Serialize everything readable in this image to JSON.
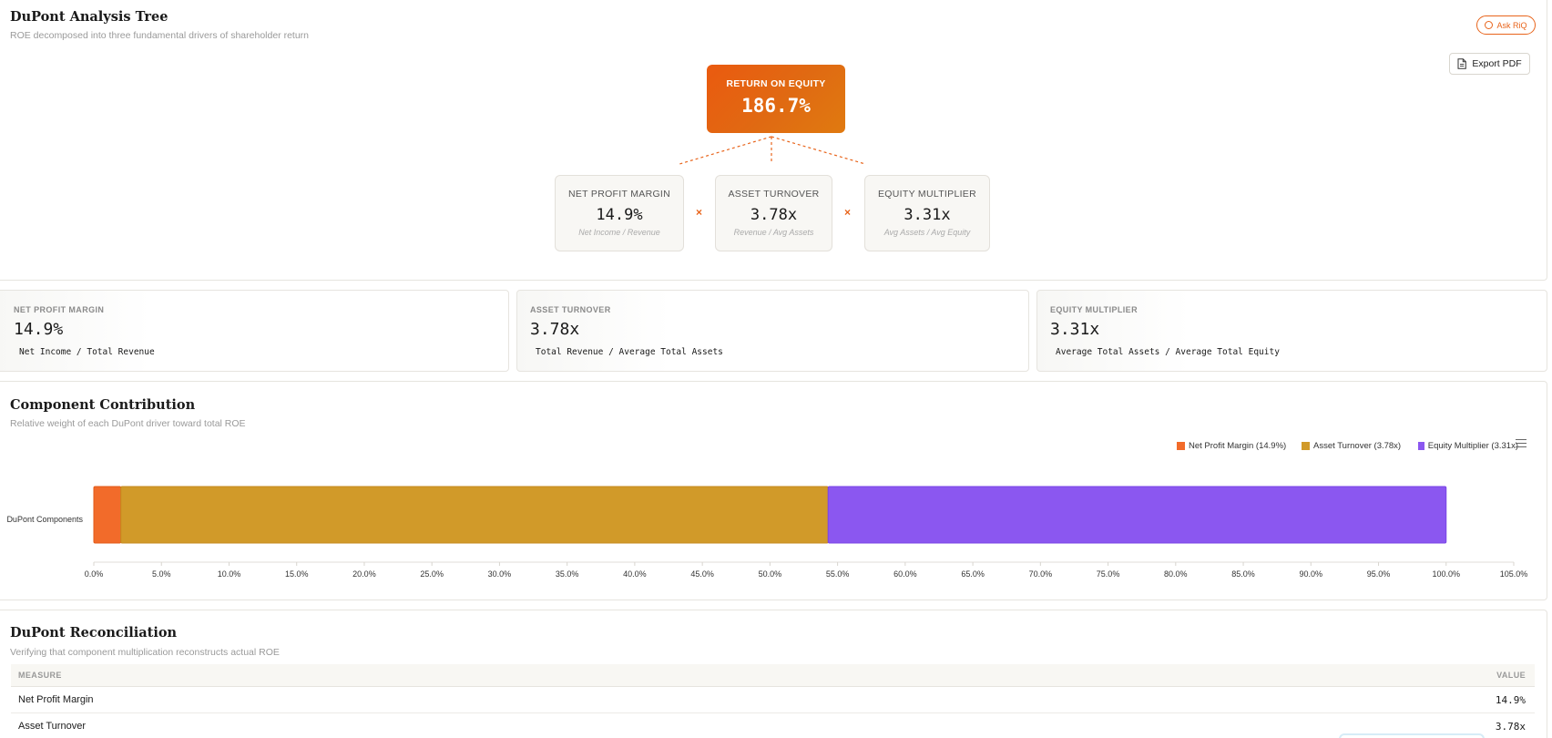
{
  "tree": {
    "title": "DuPont Analysis Tree",
    "subtitle": "ROE decomposed into three fundamental drivers of shareholder return",
    "ask_label": "Ask RiQ",
    "export_label": "Export PDF",
    "roe": {
      "label": "RETURN ON EQUITY",
      "value": "186.7%"
    },
    "operator": "×",
    "components": [
      {
        "label": "NET PROFIT MARGIN",
        "value": "14.9%",
        "formula": "Net Income / Revenue"
      },
      {
        "label": "ASSET TURNOVER",
        "value": "3.78x",
        "formula": "Revenue / Avg Assets"
      },
      {
        "label": "EQUITY MULTIPLIER",
        "value": "3.31x",
        "formula": "Avg Assets / Avg Equity"
      }
    ]
  },
  "kpis": [
    {
      "label": "NET PROFIT MARGIN",
      "value": "14.9%",
      "formula": "Net Income / Total Revenue"
    },
    {
      "label": "ASSET TURNOVER",
      "value": "3.78x",
      "formula": "Total Revenue / Average Total Assets"
    },
    {
      "label": "EQUITY MULTIPLIER",
      "value": "3.31x",
      "formula": "Average Total Assets / Average Total Equity"
    }
  ],
  "contribution": {
    "title": "Component Contribution",
    "subtitle": "Relative weight of each DuPont driver toward total ROE",
    "legend": [
      {
        "label": "Net Profit Margin (14.9%)",
        "color": "#f26b2a"
      },
      {
        "label": "Asset Turnover (3.78x)",
        "color": "#d19a29"
      },
      {
        "label": "Equity Multiplier (3.31x)",
        "color": "#8b57f0"
      }
    ]
  },
  "chart_data": {
    "type": "bar",
    "orientation": "horizontal",
    "stacked": true,
    "categories": [
      "DuPont Components"
    ],
    "series": [
      {
        "name": "Net Profit Margin (14.9%)",
        "values": [
          2.0
        ],
        "color": "#f26b2a"
      },
      {
        "name": "Asset Turnover (3.78x)",
        "values": [
          52.3
        ],
        "color": "#d19a29"
      },
      {
        "name": "Equity Multiplier (3.31x)",
        "values": [
          45.7
        ],
        "color": "#8b57f0"
      }
    ],
    "xlim": [
      0,
      105
    ],
    "xticks": [
      "0.0%",
      "5.0%",
      "10.0%",
      "15.0%",
      "20.0%",
      "25.0%",
      "30.0%",
      "35.0%",
      "40.0%",
      "45.0%",
      "50.0%",
      "55.0%",
      "60.0%",
      "65.0%",
      "70.0%",
      "75.0%",
      "80.0%",
      "85.0%",
      "90.0%",
      "95.0%",
      "100.0%",
      "105.0%"
    ],
    "legend_position": "top-right",
    "grid": false
  },
  "reconciliation": {
    "title": "DuPont Reconciliation",
    "subtitle": "Verifying that component multiplication reconstructs actual ROE",
    "columns": [
      "MEASURE",
      "VALUE"
    ],
    "rows": [
      {
        "measure": "Net Profit Margin",
        "value": "14.9%"
      },
      {
        "measure": "Asset Turnover",
        "value": "3.78x"
      }
    ]
  }
}
